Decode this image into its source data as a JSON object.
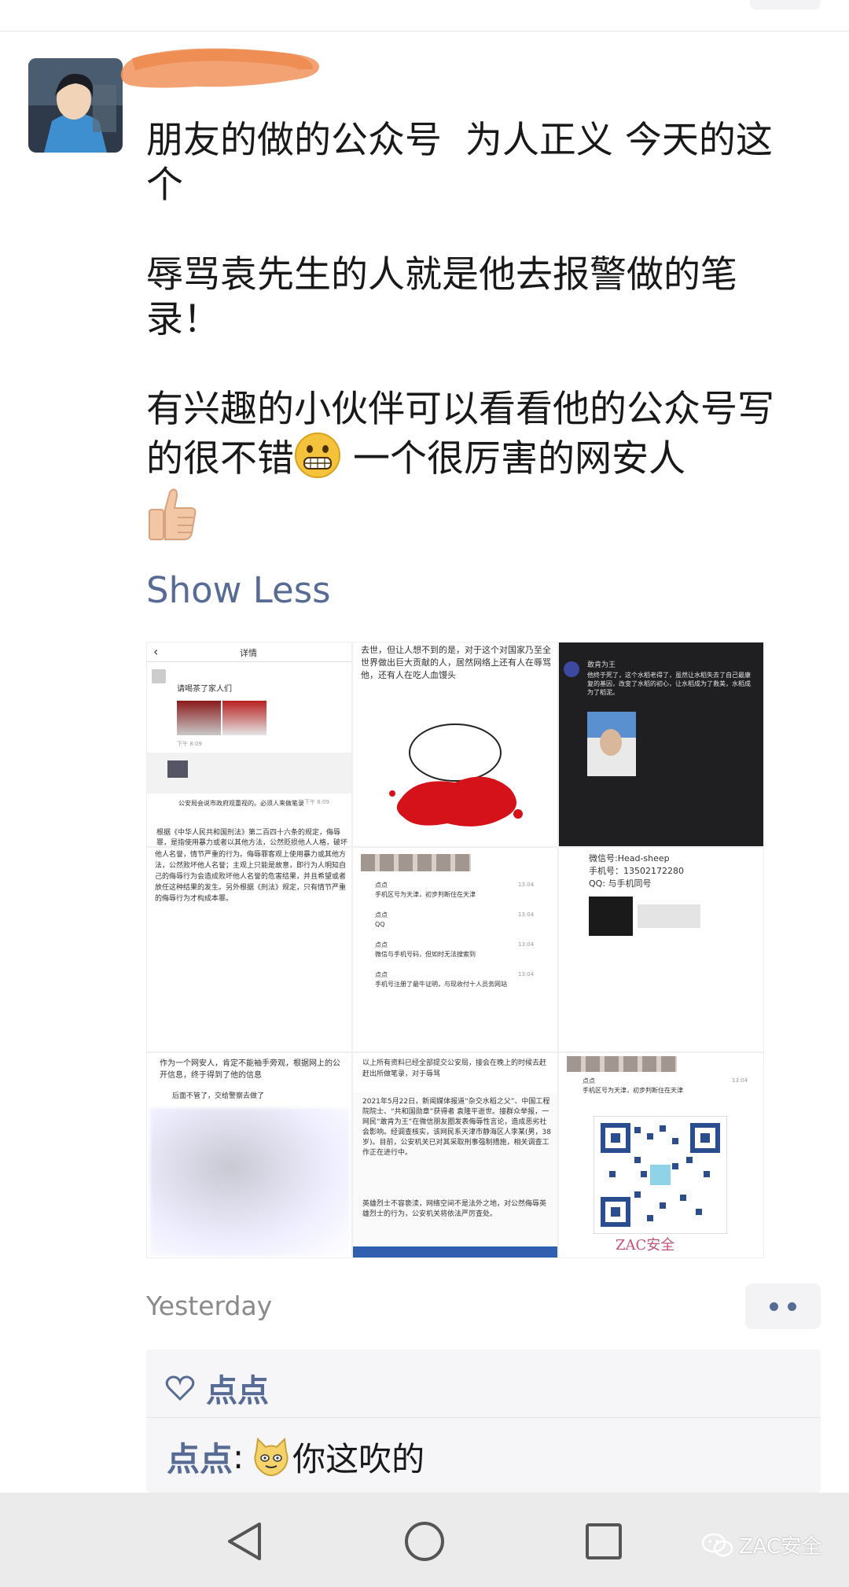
{
  "post": {
    "lines": [
      "朋友的做的公众号  为人正义 今天的这个",
      "辱骂袁先生的人就是他去报警做的笔录！",
      "有兴趣的小伙伴可以看看他的公众号写的很不错",
      "一个很厉害的网安人"
    ],
    "show_less_label": "Show Less",
    "timestamp": "Yesterday"
  },
  "images": {
    "cell1": {
      "title": "详情",
      "msg1": "请喝茶了家人们",
      "time1": "下午 8:09",
      "msg2": "公安局会说市政府观重视的。必须人来做笔录",
      "time2": "下午 8:09",
      "body": "根据《中华人民共和国刑法》第二百四十六条的规定，侮辱罪，是指使用暴力或者以其他方法，公然贬损他人人格，破坏他人名誉，情节严重的行为。侮辱罪客观上使用暴力或其他方法，公然败坏他人名誉；主观上只能是故意，即行为人明知自己的侮辱行为会造成败坏他人名誉的危害结果，并且希望或者放任这种结果的发生。另外根据《刑法》规定，只有情节严重的侮辱行为才构成本罪。"
    },
    "cell2": {
      "text": "去世，但让人想不到的是，对于这个对国家乃至全世界做出巨大贡献的人，居然网络上还有人在辱骂他，还有人在吃人血馒头"
    },
    "cell3": {
      "name": "敢肯为王",
      "text": "他终于死了，这个水稻老得了，虽然让水稻失去了自己最康复的基因，改变了水稻的初心，让水稻成为了救美，水稻成为了稻泥。"
    },
    "cell5": {
      "rows": [
        {
          "name": "点点",
          "time": "13:04",
          "msg": "手机区号为天津，初步判断住在天津"
        },
        {
          "name": "点点",
          "time": "13:04",
          "msg": "QQ"
        },
        {
          "name": "点点",
          "time": "13:04",
          "msg": "微信与手机号码，但如时无法搜索到"
        },
        {
          "name": "点点",
          "time": "13:04",
          "msg": "手机号注册了最牛证明，与现收付十人员务网站"
        }
      ]
    },
    "cell6": {
      "wechat": "微信号:Head-sheep",
      "phone": "手机号：13502172280",
      "qq": "QQ: 与手机同号"
    },
    "cell7": {
      "text": "作为一个网安人，肯定不能袖手旁观，根据网上的公开信息，终于得到了他的信息",
      "msg": "后面不管了，交给警察去做了"
    },
    "cell8": {
      "top": "以上所有资料已经全部提交公安局，接会在晚上的时候去赶赶出所做笔录，对于辱骂",
      "news": "2021年5月22日，新闻媒体报道“杂交水稻之父”、中国工程院院士、“共和国勋章”获得者 袁隆平逝世。接群众举报，一网民“敢肯为王”在微信朋友圈发表侮辱性言论，造成恶劣社会影响。经调查核实，该网民系天津市静海区人李某(男，38岁)。目前，公安机关已对其采取刑事强制措施，相关调查工作正在进行中。",
      "footer": "英雄烈士不容亵渎，网络空间不是法外之地，对公然侮辱英雄烈士的行为，公安机关将依法严厉查处。"
    },
    "cell9": {
      "row_name": "点点",
      "row_time": "13:04",
      "row_msg": "手机区号为天津，初步判断住在天津",
      "brand": "ZAC安全"
    }
  },
  "likes": {
    "names": "点点"
  },
  "comment": {
    "author": "点点",
    "text": "你这吹的"
  },
  "watermark": "ZAC安全",
  "colors": {
    "link": "#576b95",
    "text": "#191919",
    "muted": "#8a8a8a",
    "comment_bg": "#f6f6f8",
    "navbar_bg": "#ebebeb",
    "redaction": "#f0925a"
  },
  "icons": {
    "like": "heart-outline-icon",
    "back": "triangle-back-icon",
    "home": "circle-home-icon",
    "recents": "square-recents-icon",
    "more": "two-dot-more-icon"
  }
}
